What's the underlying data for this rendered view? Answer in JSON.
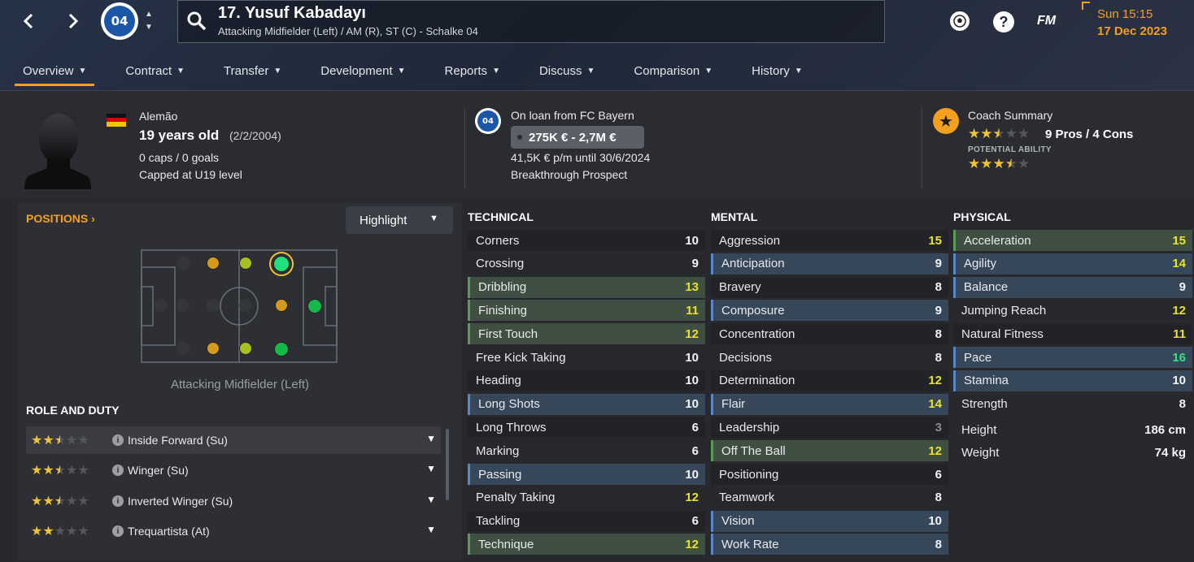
{
  "header": {
    "player_title": "17. Yusuf Kabadayı",
    "player_subtitle": "Attacking Midfielder (Left) / AM (R), ST (C) - Schalke 04",
    "club_badge_text": "04",
    "time": "Sun 15:15",
    "date": "17 Dec 2023",
    "fm_label": "FM",
    "accent_color": "#f3a01f"
  },
  "tabs": [
    {
      "label": "Overview",
      "active": true
    },
    {
      "label": "Contract"
    },
    {
      "label": "Transfer"
    },
    {
      "label": "Development"
    },
    {
      "label": "Reports"
    },
    {
      "label": "Discuss"
    },
    {
      "label": "Comparison"
    },
    {
      "label": "History"
    }
  ],
  "info": {
    "nationality": "Alemão",
    "age": "19 years old",
    "dob": "(2/2/2004)",
    "caps": "0 caps / 0 goals",
    "capped_level": "Capped at U19 level",
    "loan_text": "On loan from FC Bayern",
    "value_range": "275K € - 2,7M €",
    "wage": "41,5K € p/m until 30/6/2024",
    "status": "Breakthrough Prospect",
    "coach_title": "Coach Summary",
    "pros_cons": "9 Pros / 4 Cons",
    "potential_label": "POTENTIAL ABILITY",
    "current_ability_stars": 2.5,
    "potential_ability_stars": 3.5
  },
  "positions": {
    "title": "POSITIONS",
    "highlight_label": "Highlight",
    "position_label": "Attacking Midfielder (Left)"
  },
  "role_duty": {
    "title": "ROLE AND DUTY",
    "items": [
      {
        "label": "Inside Forward (Su)",
        "stars": 2.5
      },
      {
        "label": "Winger (Su)",
        "stars": 2.5
      },
      {
        "label": "Inverted Winger (Su)",
        "stars": 2.5
      },
      {
        "label": "Trequartista (At)",
        "stars": 2
      }
    ]
  },
  "technical": {
    "title": "TECHNICAL",
    "rows": [
      {
        "name": "Corners",
        "value": "10",
        "hl": "",
        "color": "white"
      },
      {
        "name": "Crossing",
        "value": "9",
        "hl": "",
        "color": "white"
      },
      {
        "name": "Dribbling",
        "value": "13",
        "hl": "green",
        "color": "yellow"
      },
      {
        "name": "Finishing",
        "value": "11",
        "hl": "green",
        "color": "yellow"
      },
      {
        "name": "First Touch",
        "value": "12",
        "hl": "green",
        "color": "yellow"
      },
      {
        "name": "Free Kick Taking",
        "value": "10",
        "hl": "",
        "color": "white"
      },
      {
        "name": "Heading",
        "value": "10",
        "hl": "",
        "color": "white"
      },
      {
        "name": "Long Shots",
        "value": "10",
        "hl": "blue",
        "color": "white"
      },
      {
        "name": "Long Throws",
        "value": "6",
        "hl": "",
        "color": "white"
      },
      {
        "name": "Marking",
        "value": "6",
        "hl": "",
        "color": "white"
      },
      {
        "name": "Passing",
        "value": "10",
        "hl": "blue",
        "color": "white"
      },
      {
        "name": "Penalty Taking",
        "value": "12",
        "hl": "",
        "color": "yellow"
      },
      {
        "name": "Tackling",
        "value": "6",
        "hl": "",
        "color": "white"
      },
      {
        "name": "Technique",
        "value": "12",
        "hl": "green",
        "color": "yellow"
      }
    ]
  },
  "mental": {
    "title": "MENTAL",
    "rows": [
      {
        "name": "Aggression",
        "value": "15",
        "hl": "",
        "color": "yellow"
      },
      {
        "name": "Anticipation",
        "value": "9",
        "hl": "blue",
        "color": "white"
      },
      {
        "name": "Bravery",
        "value": "8",
        "hl": "",
        "color": "white"
      },
      {
        "name": "Composure",
        "value": "9",
        "hl": "blue",
        "color": "white"
      },
      {
        "name": "Concentration",
        "value": "8",
        "hl": "",
        "color": "white"
      },
      {
        "name": "Decisions",
        "value": "8",
        "hl": "",
        "color": "white"
      },
      {
        "name": "Determination",
        "value": "12",
        "hl": "",
        "color": "yellow"
      },
      {
        "name": "Flair",
        "value": "14",
        "hl": "blue",
        "color": "yellow"
      },
      {
        "name": "Leadership",
        "value": "3",
        "hl": "",
        "color": "grey"
      },
      {
        "name": "Off The Ball",
        "value": "12",
        "hl": "green",
        "color": "yellow"
      },
      {
        "name": "Positioning",
        "value": "6",
        "hl": "",
        "color": "white"
      },
      {
        "name": "Teamwork",
        "value": "8",
        "hl": "",
        "color": "white"
      },
      {
        "name": "Vision",
        "value": "10",
        "hl": "blue",
        "color": "white"
      },
      {
        "name": "Work Rate",
        "value": "8",
        "hl": "blue",
        "color": "white"
      }
    ]
  },
  "physical": {
    "title": "PHYSICAL",
    "rows": [
      {
        "name": "Acceleration",
        "value": "15",
        "hl": "green",
        "color": "yellow"
      },
      {
        "name": "Agility",
        "value": "14",
        "hl": "blue",
        "color": "yellow"
      },
      {
        "name": "Balance",
        "value": "9",
        "hl": "blue",
        "color": "white"
      },
      {
        "name": "Jumping Reach",
        "value": "12",
        "hl": "",
        "color": "yellow"
      },
      {
        "name": "Natural Fitness",
        "value": "11",
        "hl": "",
        "color": "yellow"
      },
      {
        "name": "Pace",
        "value": "16",
        "hl": "blue",
        "color": "green"
      },
      {
        "name": "Stamina",
        "value": "10",
        "hl": "blue",
        "color": "white"
      },
      {
        "name": "Strength",
        "value": "8",
        "hl": "",
        "color": "white"
      }
    ],
    "height_label": "Height",
    "height_value": "186 cm",
    "weight_label": "Weight",
    "weight_value": "74 kg"
  }
}
